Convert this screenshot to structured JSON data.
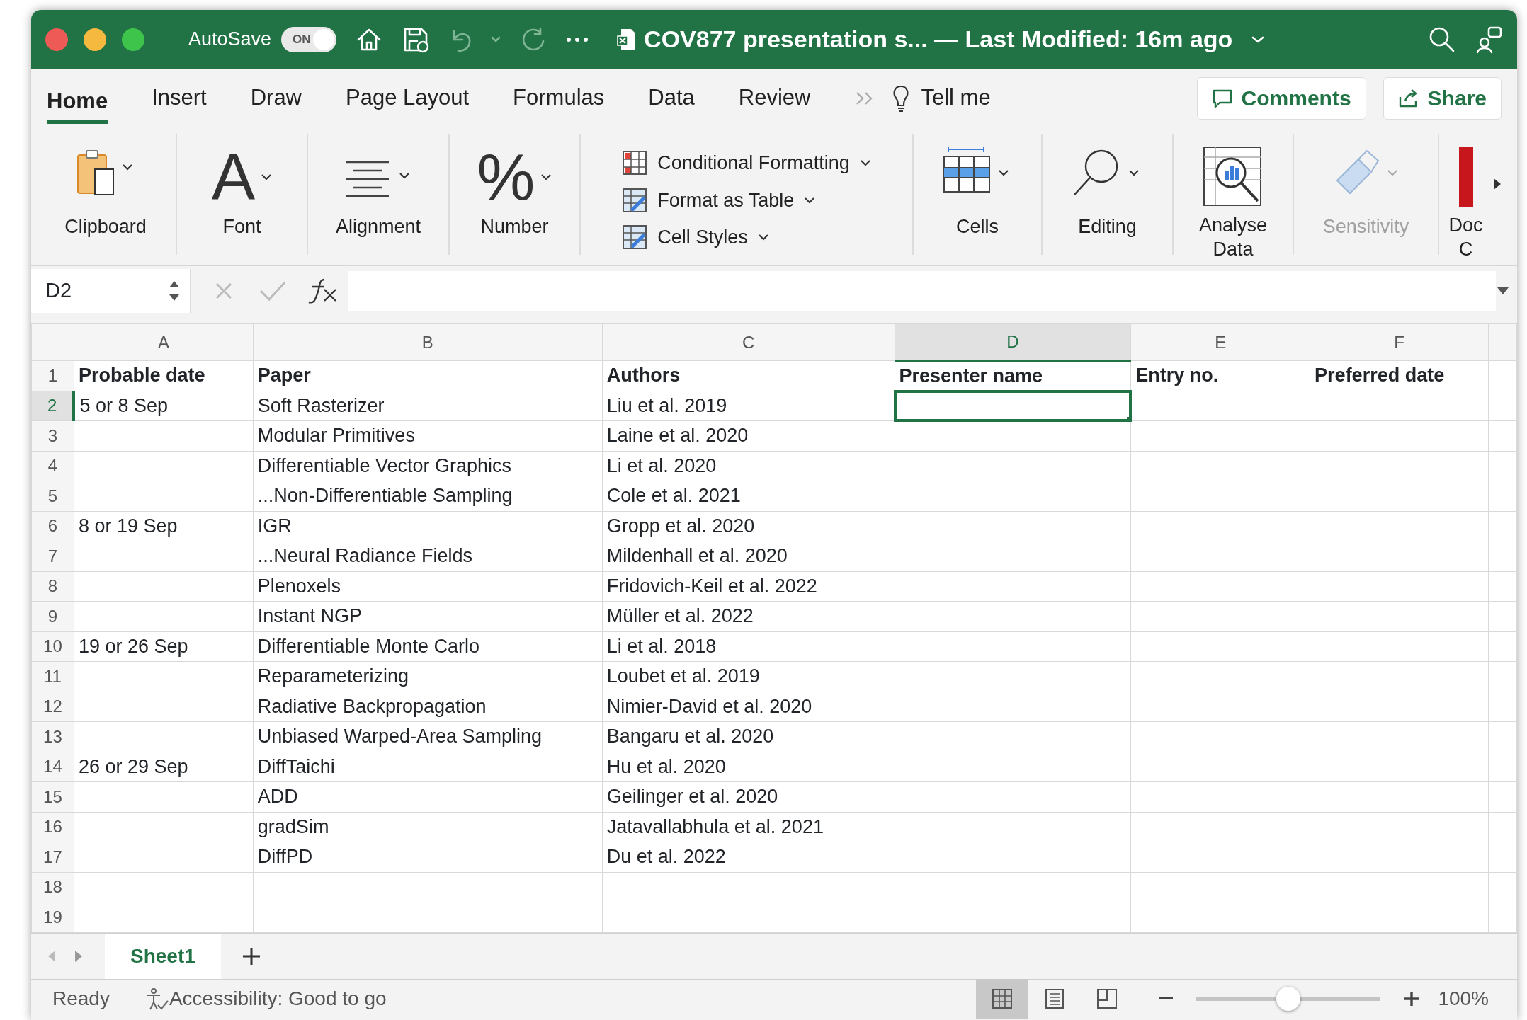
{
  "window": {
    "autosave": {
      "label": "AutoSave",
      "on": true,
      "toggle_text": "ON"
    },
    "title": "COV877 presentation s... — Last Modified: 16m ago"
  },
  "ribbon_tabs": [
    {
      "label": "Home",
      "selected": true
    },
    {
      "label": "Insert",
      "selected": false
    },
    {
      "label": "Draw",
      "selected": false
    },
    {
      "label": "Page Layout",
      "selected": false
    },
    {
      "label": "Formulas",
      "selected": false
    },
    {
      "label": "Data",
      "selected": false
    },
    {
      "label": "Review",
      "selected": false
    }
  ],
  "tell_me": "Tell me",
  "header_buttons": [
    "Comments",
    "Share"
  ],
  "ribbon_groups": [
    {
      "kind": "large",
      "label": "Clipboard",
      "disabled": false
    },
    {
      "kind": "glyph",
      "glyph": "A",
      "label": "Font",
      "disabled": false
    },
    {
      "kind": "large",
      "label": "Alignment",
      "disabled": false
    },
    {
      "kind": "glyph",
      "glyph": "%",
      "label": "Number",
      "disabled": false
    },
    {
      "kind": "stack",
      "items": [
        {
          "label": "Conditional Formatting"
        },
        {
          "label": "Format as Table"
        },
        {
          "label": "Cell Styles"
        }
      ]
    },
    {
      "kind": "large",
      "label": "Cells",
      "disabled": false
    },
    {
      "kind": "large",
      "label": "Editing",
      "disabled": false
    },
    {
      "kind": "large",
      "label": "Analyse Data",
      "disabled": false
    },
    {
      "kind": "large",
      "label": "Sensitivity",
      "disabled": true
    },
    {
      "kind": "large",
      "label": "Doc C",
      "disabled": false
    }
  ],
  "formula_bar": {
    "name_box": "D2"
  },
  "sheet": {
    "columns": [
      {
        "label": "A",
        "selected": false
      },
      {
        "label": "B",
        "selected": false
      },
      {
        "label": "C",
        "selected": false
      },
      {
        "label": "D",
        "selected": true
      },
      {
        "label": "E",
        "selected": false
      },
      {
        "label": "F",
        "selected": false
      }
    ],
    "rows": [
      {
        "number": "1",
        "kind": "header",
        "selected": false,
        "cells": [
          "Probable date",
          "Paper",
          "Authors",
          "Presenter name",
          "Entry no.",
          "Preferred date"
        ]
      },
      {
        "number": "2",
        "kind": "data",
        "selected": true,
        "cells": [
          "5 or 8 Sep",
          "Soft Rasterizer",
          "Liu et al. 2019",
          "",
          "",
          ""
        ]
      },
      {
        "number": "3",
        "kind": "data",
        "selected": false,
        "cells": [
          "",
          "Modular Primitives",
          "Laine et al. 2020",
          "",
          "",
          ""
        ]
      },
      {
        "number": "4",
        "kind": "data",
        "selected": false,
        "cells": [
          "",
          "Differentiable Vector Graphics",
          "Li et al. 2020",
          "",
          "",
          ""
        ]
      },
      {
        "number": "5",
        "kind": "data",
        "selected": false,
        "cells": [
          "",
          "...Non-Differentiable Sampling",
          "Cole et al. 2021",
          "",
          "",
          ""
        ]
      },
      {
        "number": "6",
        "kind": "data",
        "selected": false,
        "cells": [
          "8 or 19 Sep",
          "IGR",
          "Gropp et al. 2020",
          "",
          "",
          ""
        ]
      },
      {
        "number": "7",
        "kind": "data",
        "selected": false,
        "cells": [
          "",
          "...Neural Radiance Fields",
          "Mildenhall et al. 2020",
          "",
          "",
          ""
        ]
      },
      {
        "number": "8",
        "kind": "data",
        "selected": false,
        "cells": [
          "",
          "Plenoxels",
          "Fridovich-Keil et al. 2022",
          "",
          "",
          ""
        ]
      },
      {
        "number": "9",
        "kind": "data",
        "selected": false,
        "cells": [
          "",
          "Instant NGP",
          "Müller et al. 2022",
          "",
          "",
          ""
        ]
      },
      {
        "number": "10",
        "kind": "data",
        "selected": false,
        "cells": [
          "19 or 26 Sep",
          "Differentiable Monte Carlo",
          "Li et al. 2018",
          "",
          "",
          ""
        ]
      },
      {
        "number": "11",
        "kind": "data",
        "selected": false,
        "cells": [
          "",
          "Reparameterizing",
          "Loubet et al. 2019",
          "",
          "",
          ""
        ]
      },
      {
        "number": "12",
        "kind": "data",
        "selected": false,
        "cells": [
          "",
          "Radiative Backpropagation",
          "Nimier-David et al. 2020",
          "",
          "",
          ""
        ]
      },
      {
        "number": "13",
        "kind": "data",
        "selected": false,
        "cells": [
          "",
          "Unbiased Warped-Area Sampling",
          "Bangaru et al. 2020",
          "",
          "",
          ""
        ]
      },
      {
        "number": "14",
        "kind": "data",
        "selected": false,
        "cells": [
          "26 or 29 Sep",
          "DiffTaichi",
          "Hu et al. 2020",
          "",
          "",
          ""
        ]
      },
      {
        "number": "15",
        "kind": "data",
        "selected": false,
        "cells": [
          "",
          "ADD",
          "Geilinger et al. 2020",
          "",
          "",
          ""
        ]
      },
      {
        "number": "16",
        "kind": "data",
        "selected": false,
        "cells": [
          "",
          "gradSim",
          "Jatavallabhula et al. 2021",
          "",
          "",
          ""
        ]
      },
      {
        "number": "17",
        "kind": "data",
        "selected": false,
        "cells": [
          "",
          "DiffPD",
          "Du et al. 2022",
          "",
          "",
          ""
        ]
      },
      {
        "number": "18",
        "kind": "data",
        "selected": false,
        "cells": [
          "",
          "",
          "",
          "",
          "",
          ""
        ]
      },
      {
        "number": "19",
        "kind": "data",
        "selected": false,
        "cells": [
          "",
          "",
          "",
          "",
          "",
          ""
        ]
      }
    ]
  },
  "sheet_tabs": [
    {
      "label": "Sheet1",
      "selected": true
    }
  ],
  "status_bar": {
    "status": "Ready",
    "accessibility": "Accessibility: Good to go",
    "views": [
      {
        "selected": true
      },
      {
        "selected": false
      },
      {
        "selected": false
      }
    ],
    "zoom": {
      "level": 0.5,
      "reading": "100%"
    }
  }
}
